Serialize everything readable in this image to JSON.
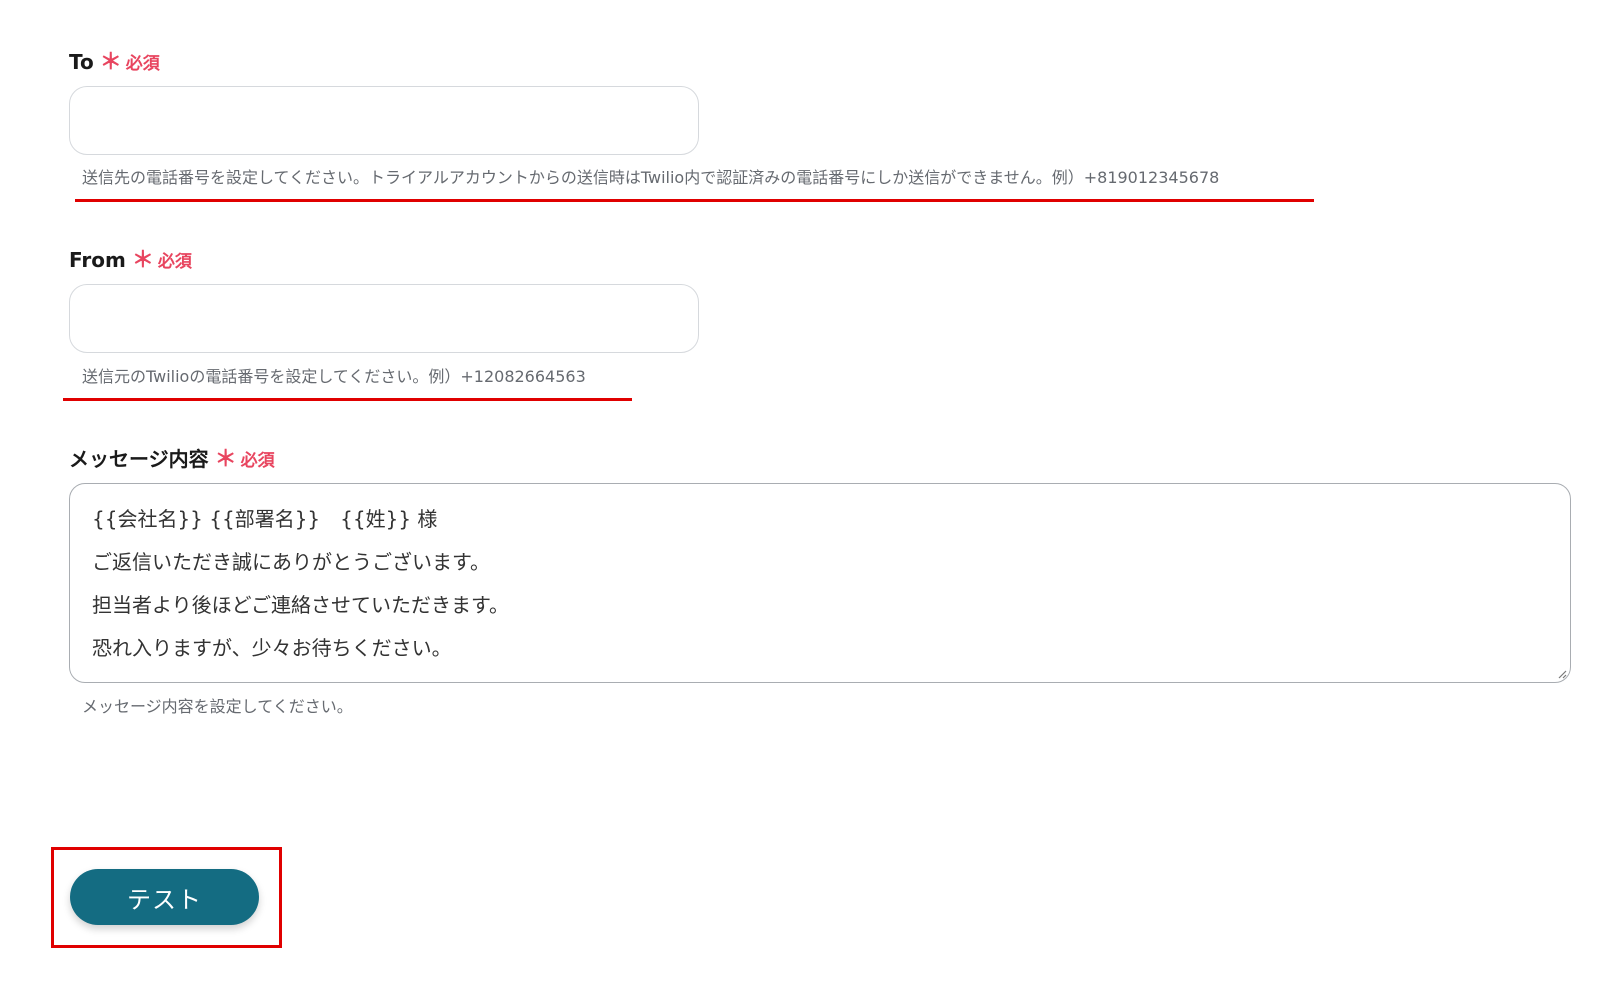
{
  "form": {
    "to": {
      "label": "To",
      "required_star": "＊",
      "required_text": "必須",
      "value": "",
      "help": "送信先の電話番号を設定してください。トライアルアカウントからの送信時はTwilio内で認証済みの電話番号にしか送信ができません。例）+819012345678"
    },
    "from": {
      "label": "From",
      "required_star": "＊",
      "required_text": "必須",
      "value": "",
      "help": "送信元のTwilioの電話番号を設定してください。例）+12082664563"
    },
    "message": {
      "label": "メッセージ内容",
      "required_star": "＊",
      "required_text": "必須",
      "lines": [
        "{{会社名}} {{部署名}}　{{姓}} 様",
        "ご返信いただき誠にありがとうございます。",
        "担当者より後ほどご連絡させていただきます。",
        "恐れ入りますが、少々お待ちください。"
      ],
      "help": "メッセージ内容を設定してください。"
    },
    "test_button_label": "テスト"
  },
  "colors": {
    "required": "#e8455f",
    "annotation": "#e00000",
    "button": "#146c82"
  }
}
